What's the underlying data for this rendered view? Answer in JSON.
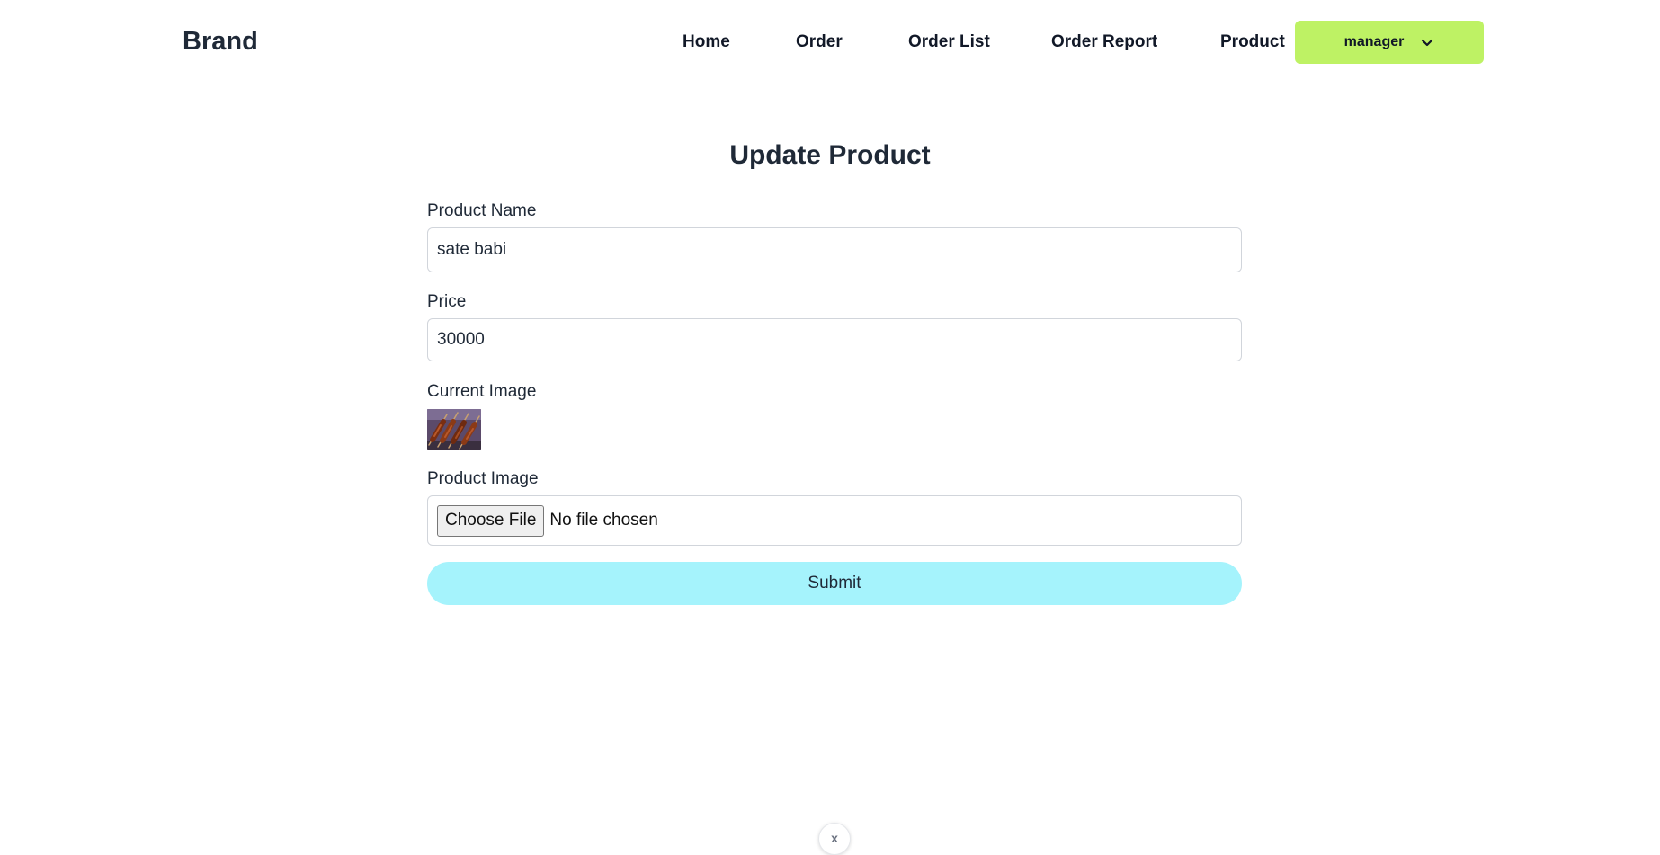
{
  "nav": {
    "brand": "Brand",
    "links": [
      "Home",
      "Order",
      "Order List",
      "Order Report",
      "Product"
    ],
    "user_label": "manager"
  },
  "page": {
    "title": "Update Product"
  },
  "form": {
    "product_name_label": "Product Name",
    "product_name_value": "sate babi",
    "price_label": "Price",
    "price_value": "30000",
    "current_image_label": "Current Image",
    "product_image_label": "Product Image",
    "file_button_label": "Choose File",
    "file_status": "No file chosen",
    "submit_label": "Submit"
  },
  "floating": {
    "close_glyph": "x"
  },
  "colors": {
    "user_menu_bg": "#bef264",
    "submit_bg": "#a5f3fc",
    "text": "#1f2937"
  }
}
